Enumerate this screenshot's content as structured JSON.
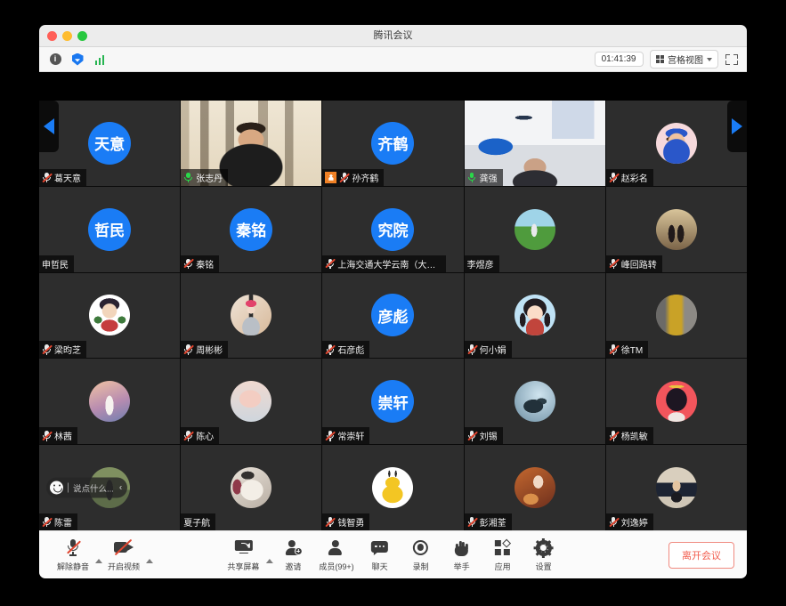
{
  "window": {
    "title": "腾讯会议",
    "traffic_lights": [
      "close",
      "minimize",
      "zoom"
    ]
  },
  "subbar": {
    "info_label": "i",
    "icons": [
      "info-icon",
      "shield-icon",
      "signal-icon"
    ],
    "timer": "01:41:39",
    "view_mode": "宫格视图",
    "fullscreen_icon": "fullscreen-icon"
  },
  "stage": {
    "nav_prev": "◀",
    "nav_next": "▶",
    "chat_pill": {
      "emoji_icon": "smiley-icon",
      "placeholder": "说点什么...",
      "collapse": "‹"
    }
  },
  "participants": [
    {
      "name": "葛天意",
      "initials": "天意",
      "muted": true,
      "host": false,
      "speaking": false,
      "kind": "initials"
    },
    {
      "name": "张志丹",
      "initials": "",
      "muted": false,
      "host": false,
      "speaking": false,
      "kind": "video-calligraphy"
    },
    {
      "name": "孙齐鹤",
      "initials": "齐鹤",
      "muted": true,
      "host": true,
      "speaking": false,
      "kind": "initials"
    },
    {
      "name": "龚强",
      "initials": "",
      "muted": false,
      "host": false,
      "speaking": true,
      "kind": "video-room"
    },
    {
      "name": "赵彩名",
      "initials": "",
      "muted": true,
      "host": false,
      "speaking": false,
      "kind": "avatar-girl-cap"
    },
    {
      "name": "申哲民",
      "initials": "哲民",
      "muted": null,
      "host": false,
      "speaking": false,
      "kind": "initials"
    },
    {
      "name": "秦铭",
      "initials": "秦铭",
      "muted": true,
      "host": false,
      "speaking": false,
      "kind": "initials"
    },
    {
      "name": "上海交通大学云南（大理...",
      "initials": "究院",
      "muted": true,
      "host": false,
      "speaking": false,
      "kind": "initials"
    },
    {
      "name": "李煜彦",
      "initials": "",
      "muted": null,
      "host": false,
      "speaking": false,
      "kind": "avatar-field"
    },
    {
      "name": "峰回路转",
      "initials": "",
      "muted": true,
      "host": false,
      "speaking": false,
      "kind": "avatar-couple"
    },
    {
      "name": "梁昀芝",
      "initials": "",
      "muted": true,
      "host": false,
      "speaking": false,
      "kind": "avatar-anime-white"
    },
    {
      "name": "周彬彬",
      "initials": "",
      "muted": true,
      "host": false,
      "speaking": false,
      "kind": "avatar-person-pink"
    },
    {
      "name": "石彦彪",
      "initials": "彦彪",
      "muted": true,
      "host": false,
      "speaking": false,
      "kind": "initials"
    },
    {
      "name": "何小娟",
      "initials": "",
      "muted": true,
      "host": false,
      "speaking": false,
      "kind": "avatar-girl-blue"
    },
    {
      "name": "徐TM",
      "initials": "",
      "muted": true,
      "host": false,
      "speaking": false,
      "kind": "avatar-street"
    },
    {
      "name": "林茜",
      "initials": "",
      "muted": true,
      "host": false,
      "speaking": false,
      "kind": "avatar-sunset"
    },
    {
      "name": "陈心",
      "initials": "",
      "muted": true,
      "host": false,
      "speaking": false,
      "kind": "avatar-pig"
    },
    {
      "name": "常崇轩",
      "initials": "崇轩",
      "muted": true,
      "host": false,
      "speaking": false,
      "kind": "initials"
    },
    {
      "name": "刘锡",
      "initials": "",
      "muted": true,
      "host": false,
      "speaking": false,
      "kind": "avatar-dragon"
    },
    {
      "name": "杨凯敏",
      "initials": "",
      "muted": true,
      "host": false,
      "speaking": false,
      "kind": "avatar-anime-red"
    },
    {
      "name": "陈雷",
      "initials": "",
      "muted": true,
      "host": false,
      "speaking": false,
      "kind": "avatar-outdoor"
    },
    {
      "name": "夏子航",
      "initials": "",
      "muted": null,
      "host": false,
      "speaking": false,
      "kind": "avatar-cat"
    },
    {
      "name": "钱智勇",
      "initials": "",
      "muted": true,
      "host": false,
      "speaking": false,
      "kind": "avatar-duck"
    },
    {
      "name": "彭湘荃",
      "initials": "",
      "muted": true,
      "host": false,
      "speaking": false,
      "kind": "avatar-warm"
    },
    {
      "name": "刘逸婷",
      "initials": "",
      "muted": true,
      "host": false,
      "speaking": false,
      "kind": "avatar-kid"
    }
  ],
  "bottombar": {
    "controls": [
      {
        "label": "解除静音",
        "icon": "mic-muted-icon",
        "has_caret": true
      },
      {
        "label": "开启视频",
        "icon": "camera-off-icon",
        "has_caret": true
      },
      {
        "label": "共享屏幕",
        "icon": "share-screen-icon",
        "has_caret": true
      },
      {
        "label": "邀请",
        "icon": "invite-icon",
        "has_caret": false
      },
      {
        "label": "成员(99+)",
        "icon": "members-icon",
        "has_caret": false
      },
      {
        "label": "聊天",
        "icon": "chat-icon",
        "has_caret": false
      },
      {
        "label": "录制",
        "icon": "record-icon",
        "has_caret": false
      },
      {
        "label": "举手",
        "icon": "raise-hand-icon",
        "has_caret": false
      },
      {
        "label": "应用",
        "icon": "apps-icon",
        "has_caret": false
      },
      {
        "label": "设置",
        "icon": "settings-icon",
        "has_caret": false
      }
    ],
    "leave_label": "离开会议"
  },
  "colors": {
    "accent_blue": "#1a7cf5",
    "speaking_green": "#2ad84a",
    "host_orange": "#f08125",
    "leave_red": "#f25c4d",
    "muted_red": "#e0452f"
  }
}
